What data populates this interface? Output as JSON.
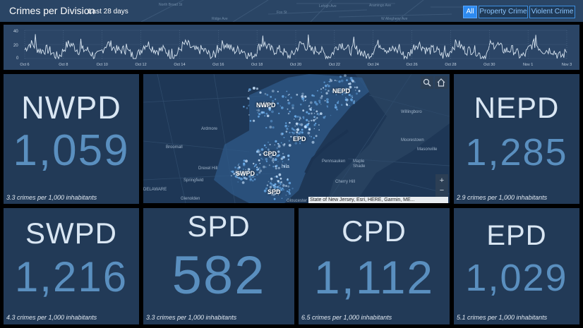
{
  "header": {
    "title": "Crimes per Division",
    "subtitle": "Last 28 days",
    "streets": [
      "North Broad St",
      "Lehigh Ave",
      "Aramingo Ave",
      "Fox St",
      "Ridge Ave",
      "W Allegheny Ave"
    ]
  },
  "filters": [
    {
      "label": "All",
      "active": true
    },
    {
      "label": "Property Crime",
      "active": false
    },
    {
      "label": "Violent Crime",
      "active": false
    }
  ],
  "timeline": {
    "y_ticks": [
      "40",
      "20",
      "0"
    ],
    "x_ticks": [
      "Oct 6",
      "Oct 8",
      "Oct 10",
      "Oct 12",
      "Oct 14",
      "Oct 16",
      "Oct 18",
      "Oct 20",
      "Oct 22",
      "Oct 24",
      "Oct 26",
      "Oct 28",
      "Oct 30",
      "Nov 1",
      "Nov 3"
    ]
  },
  "divisions": {
    "nwpd": {
      "name": "NWPD",
      "count": "1,059",
      "rate": "3.3 crimes per 1,000 inhabitants"
    },
    "nepd": {
      "name": "NEPD",
      "count": "1,285",
      "rate": "2.9 crimes per 1,000 inhabitants"
    },
    "swpd": {
      "name": "SWPD",
      "count": "1,216",
      "rate": "4.3 crimes per 1,000 inhabitants"
    },
    "spd": {
      "name": "SPD",
      "count": "582",
      "rate": "3.3 crimes per 1,000 inhabitants"
    },
    "cpd": {
      "name": "CPD",
      "count": "1,112",
      "rate": "6.5 crimes per 1,000 inhabitants"
    },
    "epd": {
      "name": "EPD",
      "count": "1,029",
      "rate": "5.1 crimes per 1,000 inhabitants"
    }
  },
  "map": {
    "labels": {
      "nepd": "NEPD",
      "nwpd": "NWPD",
      "epd": "EPD",
      "cpd": "CPD",
      "swpd": "SWPD",
      "spd": "SPD"
    },
    "towns": {
      "ardmore": "Ardmore",
      "broomall": "Broomall",
      "drexel": "Drexel Hill",
      "springfield": "Springfield",
      "glenolden": "Glenolden",
      "willingboro": "Willingboro",
      "pennsauken": "Pennsauken",
      "maple": "Maple",
      "shade": "Shade",
      "cherry": "Cherry Hill",
      "moorestown": "Moorestown",
      "masonville": "Masonville",
      "delaware": "DELAWARE",
      "gloucester": "Gloucester",
      "phila": "hila"
    },
    "attribution": "State of New Jersey, Esri, HERE, Garmin, ME...",
    "zoom_in": "+",
    "zoom_out": "−"
  },
  "colors": {
    "accent": "#2d8af0",
    "panel": "#223a57",
    "number": "#5a8fbf"
  }
}
